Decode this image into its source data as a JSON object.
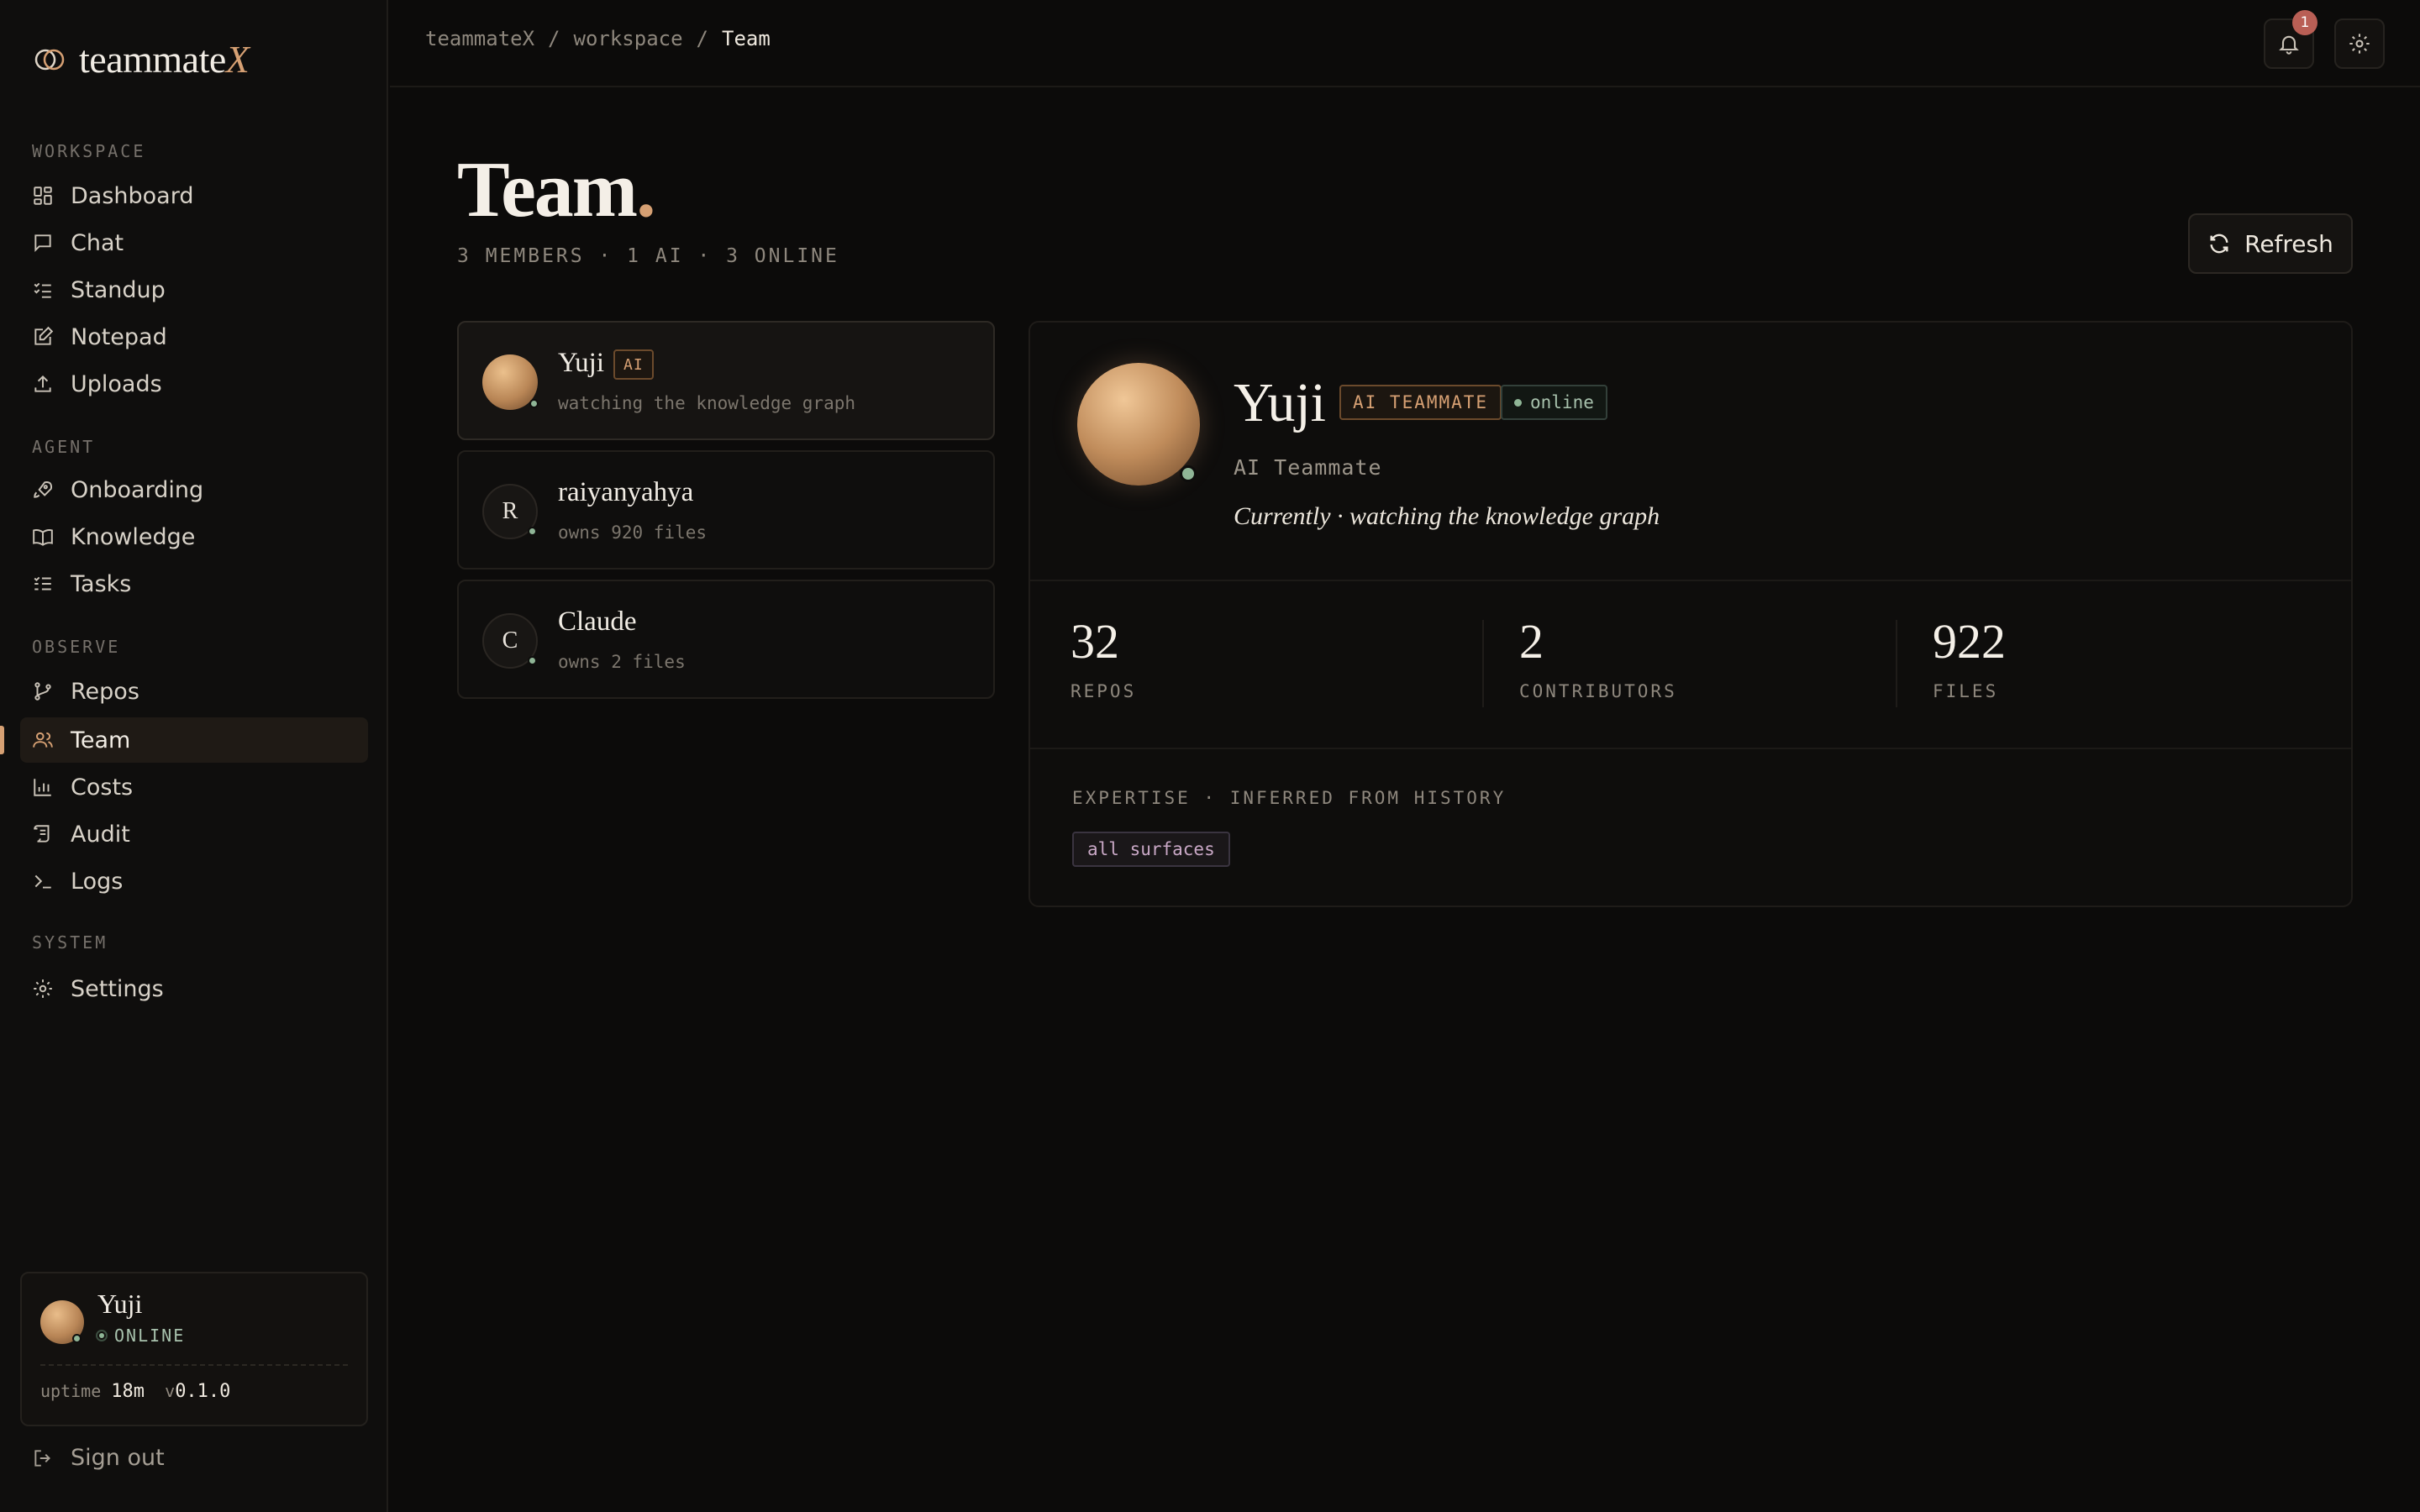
{
  "brand": {
    "name": "teammate",
    "accent": "X"
  },
  "sidebar": {
    "sections": [
      {
        "label": "WORKSPACE",
        "items": [
          {
            "label": "Dashboard",
            "icon": "grid-icon"
          },
          {
            "label": "Chat",
            "icon": "chat-icon"
          },
          {
            "label": "Standup",
            "icon": "checklist-icon"
          },
          {
            "label": "Notepad",
            "icon": "edit-icon"
          },
          {
            "label": "Uploads",
            "icon": "upload-icon"
          }
        ]
      },
      {
        "label": "AGENT",
        "items": [
          {
            "label": "Onboarding",
            "icon": "rocket-icon"
          },
          {
            "label": "Knowledge",
            "icon": "book-icon"
          },
          {
            "label": "Tasks",
            "icon": "tasks-icon"
          }
        ]
      },
      {
        "label": "OBSERVE",
        "items": [
          {
            "label": "Repos",
            "icon": "branch-icon"
          },
          {
            "label": "Team",
            "icon": "users-icon",
            "active": true
          },
          {
            "label": "Costs",
            "icon": "bar-chart-icon"
          },
          {
            "label": "Audit",
            "icon": "scroll-icon"
          },
          {
            "label": "Logs",
            "icon": "terminal-icon"
          }
        ]
      },
      {
        "label": "SYSTEM",
        "items": [
          {
            "label": "Settings",
            "icon": "gear-icon"
          }
        ]
      }
    ],
    "user": {
      "name": "Yuji",
      "status": "ONLINE",
      "uptime_label": "uptime",
      "uptime": "18m",
      "version_prefix": "v",
      "version": "0.1.0"
    },
    "signout": "Sign out"
  },
  "breadcrumb": {
    "root": "teammateX",
    "sep": "/",
    "middle": "workspace",
    "current": "Team"
  },
  "notifications": {
    "count": "1"
  },
  "page": {
    "title": "Team",
    "title_dot": ".",
    "subtitle": "3 MEMBERS · 1 AI · 3 ONLINE",
    "refresh": "Refresh"
  },
  "members": [
    {
      "name": "Yuji",
      "tag": "AI",
      "sub": "watching the knowledge graph",
      "initial": ""
    },
    {
      "name": "raiyanyahya",
      "tag": "",
      "sub": "owns 920 files",
      "initial": "R"
    },
    {
      "name": "Claude",
      "tag": "",
      "sub": "owns 2 files",
      "initial": "C"
    }
  ],
  "detail": {
    "name": "Yuji",
    "tag_ai": "AI TEAMMATE",
    "tag_status": "online",
    "role": "AI Teammate",
    "status_text": "Currently · watching the knowledge graph",
    "stats": [
      {
        "value": "32",
        "label": "REPOS"
      },
      {
        "value": "2",
        "label": "CONTRIBUTORS"
      },
      {
        "value": "922",
        "label": "FILES"
      }
    ],
    "expertise_label": "EXPERTISE · INFERRED FROM HISTORY",
    "expertise": [
      "all surfaces"
    ]
  },
  "colors": {
    "accent": "#d6a073",
    "online": "#8fb596",
    "background": "#0c0b0a"
  }
}
